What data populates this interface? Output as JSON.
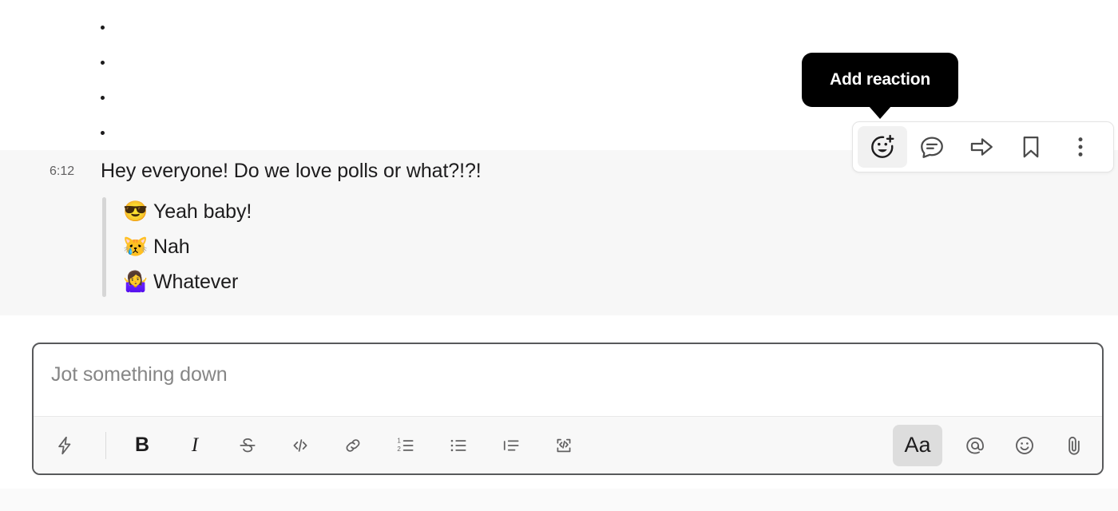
{
  "top_list": {
    "items": [
      {
        "bullet": "•",
        "text": ""
      },
      {
        "bullet": "•",
        "text": ""
      },
      {
        "bullet": "•",
        "text": ""
      },
      {
        "bullet": "•",
        "text": ""
      }
    ]
  },
  "message": {
    "timestamp": "6:12",
    "text": "Hey everyone! Do we love polls or what?!?!",
    "poll_options": [
      {
        "emoji": "😎",
        "label": "Yeah baby!"
      },
      {
        "emoji": "😿",
        "label": "Nah"
      },
      {
        "emoji": "🤷‍♀️",
        "label": "Whatever"
      }
    ]
  },
  "tooltip": {
    "text": "Add reaction"
  },
  "action_toolbar": {
    "buttons": [
      {
        "name": "add-reaction",
        "label": "Add reaction",
        "active": true
      },
      {
        "name": "reply-in-thread",
        "label": "Reply in thread",
        "active": false
      },
      {
        "name": "forward-message",
        "label": "Forward message",
        "active": false
      },
      {
        "name": "save-for-later",
        "label": "Save for later",
        "active": false
      },
      {
        "name": "more-actions",
        "label": "More actions",
        "active": false
      }
    ]
  },
  "composer": {
    "placeholder": "Jot something down",
    "value": "",
    "toolbar_left": [
      {
        "name": "shortcuts",
        "label": "Shortcuts",
        "glyph": "lightning-bolt-icon"
      },
      {
        "name": "bold",
        "label": "B",
        "glyph": "bold-icon"
      },
      {
        "name": "italic",
        "label": "I",
        "glyph": "italic-icon"
      },
      {
        "name": "strikethrough",
        "label": "Strikethrough",
        "glyph": "strikethrough-icon"
      },
      {
        "name": "code",
        "label": "Code",
        "glyph": "code-icon"
      },
      {
        "name": "link",
        "label": "Link",
        "glyph": "link-icon"
      },
      {
        "name": "ordered-list",
        "label": "Ordered list",
        "glyph": "ordered-list-icon"
      },
      {
        "name": "bulleted-list",
        "label": "Bulleted list",
        "glyph": "bulleted-list-icon"
      },
      {
        "name": "blockquote",
        "label": "Blockquote",
        "glyph": "blockquote-icon"
      },
      {
        "name": "code-block",
        "label": "Code block",
        "glyph": "code-block-icon"
      }
    ],
    "toolbar_right": [
      {
        "name": "formatting",
        "label": "Aa",
        "active": true
      },
      {
        "name": "mention",
        "label": "Mention someone",
        "active": false
      },
      {
        "name": "emoji",
        "label": "Emoji",
        "active": false
      },
      {
        "name": "attach",
        "label": "Attach file",
        "active": false
      }
    ]
  },
  "colors": {
    "message_hover_bg": "#f7f7f7",
    "tooltip_bg": "#000000",
    "composer_border": "#58595b",
    "toolbar_bg": "#f8f8f8",
    "text": "#1d1c1d",
    "muted_text": "#616061",
    "placeholder": "#868686",
    "quote_bar": "#d6d6d6"
  }
}
